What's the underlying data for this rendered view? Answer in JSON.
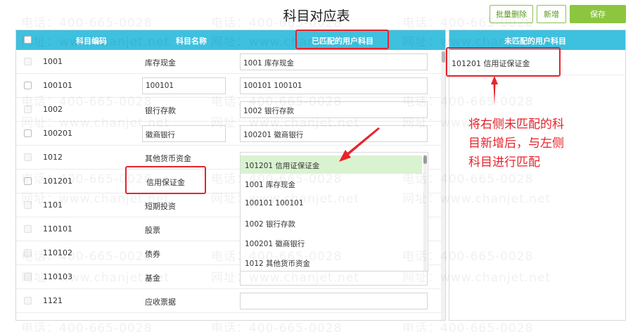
{
  "title": "科目对应表",
  "toolbar": {
    "batch_delete": "批量删除",
    "add_new": "新增",
    "save": "保存"
  },
  "left_table": {
    "headers": {
      "code": "科目编码",
      "name": "科目名称",
      "matched": "已匹配的用户科目"
    },
    "rows": [
      {
        "code": "1001",
        "name": "库存现金",
        "matched": "1001 库存现金"
      },
      {
        "code": "100101",
        "name": "100101",
        "matched": "100101 100101"
      },
      {
        "code": "1002",
        "name": "银行存款",
        "matched": "1002 银行存款"
      },
      {
        "code": "100201",
        "name": "徽商银行",
        "matched": "100201 徽商银行"
      },
      {
        "code": "1012",
        "name": "其他货币资金",
        "matched": ""
      },
      {
        "code": "101201",
        "name": "信用保证金",
        "matched": ""
      },
      {
        "code": "1101",
        "name": "短期投资",
        "matched": ""
      },
      {
        "code": "110101",
        "name": "股票",
        "matched": ""
      },
      {
        "code": "110102",
        "name": "债券",
        "matched": ""
      },
      {
        "code": "110103",
        "name": "基金",
        "matched": ""
      },
      {
        "code": "1121",
        "name": "应收票据",
        "matched": ""
      }
    ]
  },
  "dropdown": {
    "options": [
      "101201 信用证保证金",
      "1001 库存现金",
      "100101 100101",
      "1002 银行存款",
      "100201 徽商银行",
      "1012 其他货币资金"
    ],
    "selected_index": 0
  },
  "right_panel": {
    "header": "未匹配的用户科目",
    "items": [
      "101201 信用证保证金"
    ]
  },
  "annotation": {
    "lines": [
      "将右侧未匹配的科",
      "目新增后，与左侧",
      "科目进行匹配"
    ],
    "color": "#e8232b"
  },
  "watermark": {
    "phone": "电话：400-665-0028",
    "site": "网址：www.chanjet.net"
  },
  "colors": {
    "header_bg": "#3ec0df",
    "accent_green": "#8cc63f",
    "highlight": "#d9f3d0"
  }
}
